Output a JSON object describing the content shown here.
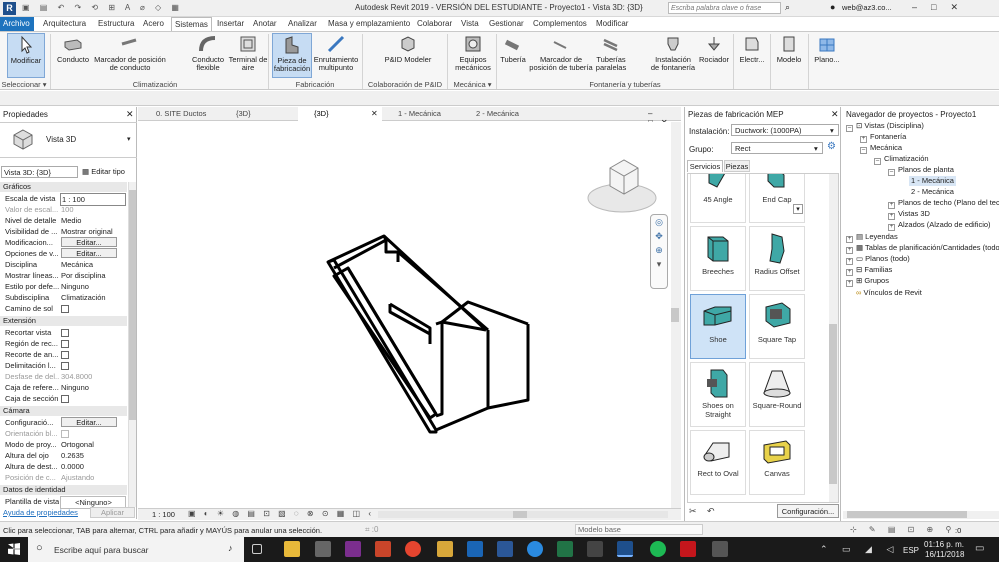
{
  "titlebar": {
    "title": "Autodesk Revit 2019 - VERSIÓN DEL ESTUDIANTE - Proyecto1 - Vista 3D: {3D}",
    "search_placeholder": "Escriba palabra clave o frase",
    "user": "web@az3.co..."
  },
  "menu": {
    "items": [
      "Archivo",
      "Arquitectura",
      "Estructura",
      "Acero",
      "Sistemas",
      "Insertar",
      "Anotar",
      "Analizar",
      "Masa y emplazamiento",
      "Colaborar",
      "Vista",
      "Gestionar",
      "Complementos",
      "Modificar"
    ],
    "active": "Sistemas"
  },
  "ribbon": {
    "buttons": [
      "Modificar",
      "Conducto",
      "Marcador de posición de conducto",
      "Conducto flexible",
      "Terminal de aire",
      "Pieza de fabricación",
      "Enrutamiento multipunto",
      "P&ID Modeler",
      "Equipos mecánicos",
      "Tubería",
      "Marcador de posición de tubería",
      "Tuberías paralelas",
      "Instalación de fontanería",
      "Rociador",
      "Electr...",
      "Modelo",
      "Plano..."
    ],
    "panels": [
      "Seleccionar ▾",
      "Climatización",
      "Fabricación",
      "Colaboración de P&ID",
      "Mecánica ▾",
      "Fontanería y tuberías"
    ]
  },
  "properties": {
    "title": "Propiedades",
    "type_name": "Vista 3D",
    "selector": "Vista 3D: {3D}",
    "edit_type": "Editar tipo",
    "sections": {
      "graphics": "Gráficos",
      "extension": "Extensión",
      "camera": "Cámara",
      "identity": "Datos de identidad"
    },
    "rows": [
      {
        "k": "Escala de vista",
        "v": "1 : 100"
      },
      {
        "k": "Valor de escal...",
        "v": "100"
      },
      {
        "k": "Nivel de detalle",
        "v": "Medio"
      },
      {
        "k": "Visibilidad de ...",
        "v": "Mostrar original"
      },
      {
        "k": "Modificacion...",
        "v": "Editar..."
      },
      {
        "k": "Opciones de v...",
        "v": "Editar..."
      },
      {
        "k": "Disciplina",
        "v": "Mecánica"
      },
      {
        "k": "Mostrar líneas...",
        "v": "Por disciplina"
      },
      {
        "k": "Estilo por defe...",
        "v": "Ninguno"
      },
      {
        "k": "Subdisciplina",
        "v": "Climatización"
      },
      {
        "k": "Camino de sol",
        "v": ""
      },
      {
        "k": "Recortar vista",
        "v": ""
      },
      {
        "k": "Región de rec...",
        "v": ""
      },
      {
        "k": "Recorte de an...",
        "v": ""
      },
      {
        "k": "Delimitación l...",
        "v": ""
      },
      {
        "k": "Desfase de del...",
        "v": "304.8000"
      },
      {
        "k": "Caja de refere...",
        "v": "Ninguno"
      },
      {
        "k": "Caja de sección",
        "v": ""
      },
      {
        "k": "Configuració...",
        "v": "Editar..."
      },
      {
        "k": "Orientación bl...",
        "v": ""
      },
      {
        "k": "Modo de proy...",
        "v": "Ortogonal"
      },
      {
        "k": "Altura del ojo",
        "v": "0.2635"
      },
      {
        "k": "Altura de dest...",
        "v": "0.0000"
      },
      {
        "k": "Posición de c...",
        "v": "Ajustando"
      },
      {
        "k": "Plantilla de vista",
        "v": "<Ninguno>"
      }
    ],
    "help": "Ayuda de propiedades",
    "apply": "Aplicar"
  },
  "view_tabs": [
    "0. SITE Ductos",
    "{3D}",
    "{3D}",
    "1 - Mecánica",
    "2 - Mecánica"
  ],
  "viewbar": {
    "scale": "1 : 100"
  },
  "fabrication": {
    "title": "Piezas de fabricación MEP",
    "install_label": "Instalación:",
    "install_value": "Ductwork: (1000PA)",
    "group_label": "Grupo:",
    "group_value": "Rect",
    "tabs": [
      "Servicios",
      "Piezas"
    ],
    "parts": [
      "45 Angle",
      "End Cap",
      "Breeches",
      "Radius Offset",
      "Shoe",
      "Square Tap",
      "Shoes on Straight",
      "Square-Round",
      "Rect to Oval",
      "Canvas"
    ],
    "selected": "Shoe",
    "config_button": "Configuración..."
  },
  "navigator": {
    "title": "Navegador de proyectos - Proyecto1",
    "nodes": [
      "Vistas (Disciplina)",
      "Fontanería",
      "Mecánica",
      "Climatización",
      "Planos de planta",
      "1 - Mecánica",
      "2 - Mecánica",
      "Planos de techo (Plano del techo)",
      "Vistas 3D",
      "Alzados (Alzado de edificio)",
      "Leyendas",
      "Tablas de planificación/Cantidades (todo)",
      "Planos (todo)",
      "Familias",
      "Grupos",
      "Vínculos de Revit"
    ]
  },
  "status": {
    "message": "Clic para seleccionar, TAB para alternar, CTRL para añadir y MAYÚS para anular una selección.",
    "model": "Modelo base",
    "zero": ":0"
  },
  "taskbar": {
    "search": "Escribe aquí para buscar",
    "time": "01:16 p. m.",
    "date": "16/11/2018",
    "lang": "ESP"
  },
  "colors": {
    "accent": "#1f6fbf",
    "part_teal": "#3fa8a6",
    "menu_active": "#1e73be"
  }
}
